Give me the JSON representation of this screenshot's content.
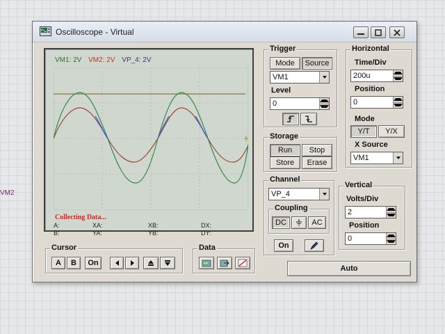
{
  "background": {
    "side_label": "VM2"
  },
  "window": {
    "title": "Oscilloscope - Virtual",
    "buttons": [
      "minimize",
      "maximize",
      "close"
    ]
  },
  "scope": {
    "legend": [
      {
        "label": "VM1: 2V",
        "color": "#2e8b2e"
      },
      {
        "label": "VM2: 2V",
        "color": "#b23a2a"
      },
      {
        "label": "VP_4: 2V",
        "color": "#3a3a8a"
      }
    ],
    "status": "Collecting Data...",
    "cursor_readout": {
      "a": "A:",
      "b": "B:",
      "xa": "XA:",
      "ya": "YA:",
      "xb": "XB:",
      "yb": "YB:",
      "dx": "DX:",
      "dy": "DY:"
    },
    "colors": {
      "screen": "#d0d7cf",
      "grid": "#9fa9a0",
      "trace_vm1": "#2e8b4a",
      "trace_vm2": "#9b4a3a",
      "trace_vp4": "#4a5ad0",
      "trace_flat": "#8a7a3a"
    }
  },
  "cursor": {
    "title": "Cursor",
    "buttons": [
      "A",
      "B",
      "On"
    ]
  },
  "data_panel": {
    "title": "Data"
  },
  "trigger": {
    "title": "Trigger",
    "mode_label": "Mode",
    "source_label": "Source",
    "source_value": "VM1",
    "level_label": "Level",
    "level_value": "0"
  },
  "storage": {
    "title": "Storage",
    "run": "Run",
    "stop": "Stop",
    "store": "Store",
    "erase": "Erase"
  },
  "horizontal": {
    "title": "Horizontal",
    "time_div_label": "Time/Div",
    "time_div_value": "200u",
    "position_label": "Position",
    "position_value": "0",
    "mode_label": "Mode",
    "mode_yt": "Y/T",
    "mode_yx": "Y/X",
    "xsource_label": "X Source",
    "xsource_value": "VM1"
  },
  "channel": {
    "title": "Channel",
    "value": "VP_4",
    "coupling_title": "Coupling",
    "dc": "DC",
    "ac": "AC",
    "on": "On"
  },
  "vertical": {
    "title": "Vertical",
    "volts_div_label": "Volts/Div",
    "volts_div_value": "2",
    "position_label": "Position",
    "position_value": "0"
  },
  "auto": {
    "label": "Auto"
  }
}
